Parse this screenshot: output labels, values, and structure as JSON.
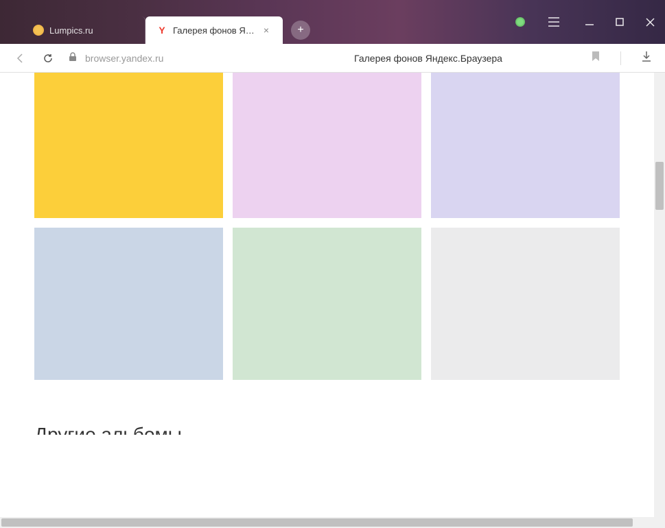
{
  "tabs": [
    {
      "title": "Lumpics.ru",
      "active": false,
      "favicon_color": "#e8a33d"
    },
    {
      "title": "Галерея фонов Яндекс",
      "active": true,
      "favicon": "Y"
    }
  ],
  "new_tab": "+",
  "address_bar": {
    "url": "browser.yandex.ru",
    "page_title": "Галерея фонов Яндекс.Браузера"
  },
  "gallery": {
    "colors": [
      "#fccf3a",
      "#edd2f0",
      "#d9d5f1",
      "#cad6e6",
      "#d1e6d2",
      "#ebebec"
    ],
    "section_title": "Другие альбомы"
  },
  "icons": {
    "close": "×"
  }
}
